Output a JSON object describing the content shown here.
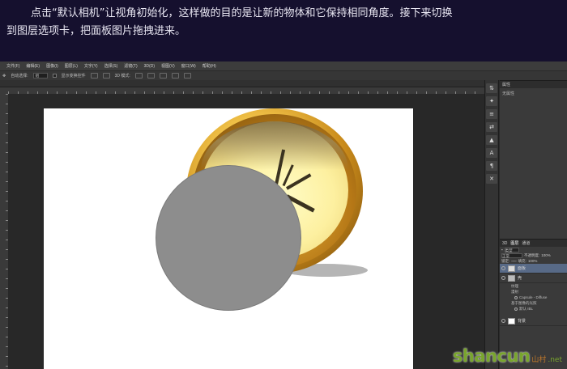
{
  "caption": {
    "line1": "点击“默认相机”让视角初始化，这样做的目的是让新的物体和它保持相同角度。接下来切换",
    "line2": "到图层选项卡，把面板图片拖拽进来。"
  },
  "menubar": [
    "文件(F)",
    "编辑(E)",
    "图像(I)",
    "图层(L)",
    "文字(Y)",
    "选择(S)",
    "滤镜(T)",
    "3D(D)",
    "视图(V)",
    "窗口(W)",
    "帮助(H)"
  ],
  "options": {
    "auto_select": "自动选择:",
    "target": "组",
    "show_transform": "显示变换控件",
    "mode_3d": "3D 模式:"
  },
  "tools": [
    "⇅",
    "✦",
    "≡",
    "⇄",
    "▲",
    "A",
    "¶",
    "✕"
  ],
  "properties_panel": {
    "tabs": [
      "属性"
    ],
    "subtitle": "无属性"
  },
  "layers_panel": {
    "tabs": [
      "3D",
      "图层",
      "通道"
    ],
    "kind_label": "类型",
    "blend_mode": "正常",
    "opacity_label": "不透明度:",
    "opacity_value": "100%",
    "lock_label": "锁定:",
    "fill_label": "填充:",
    "fill_value": "100%",
    "layers": [
      {
        "name": "面板",
        "selected": true
      },
      {
        "name": "壳",
        "selected": false
      }
    ],
    "sublayers": [
      "纹理",
      "漫射",
      "Capsule - Diffuse",
      "基于图像的光照",
      "默认 IBL"
    ],
    "background": "背景"
  },
  "watermark": {
    "brand": "shancun",
    "domain": ".net",
    "cn": "山村"
  },
  "colors": {
    "caption_bg": "#15102e",
    "canvas": "#ffffff",
    "sphere": "#8d8d8d",
    "gold": "#f2c44a",
    "selected_layer": "#586a87"
  }
}
